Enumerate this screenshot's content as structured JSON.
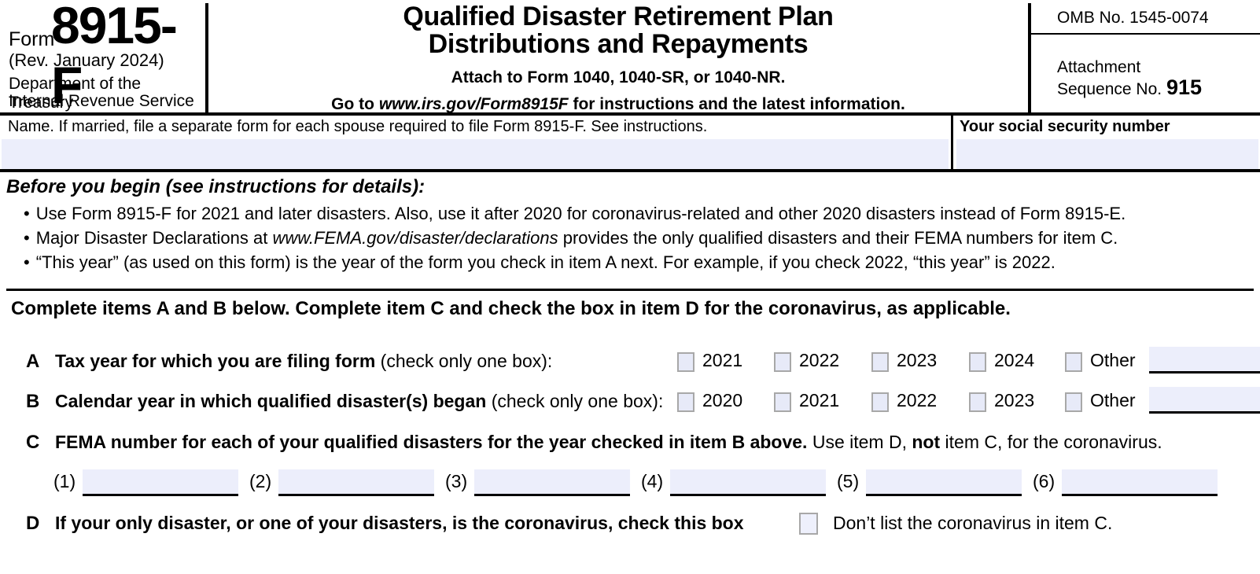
{
  "header": {
    "form_word": "Form",
    "form_number": "8915-F",
    "revision": "(Rev. January 2024)",
    "department_line1": "Department of the Treasury",
    "department_line2": "Internal Revenue Service",
    "title_line1": "Qualified Disaster Retirement Plan",
    "title_line2": "Distributions and Repayments",
    "attach_to": "Attach to Form 1040, 1040-SR, or 1040-NR.",
    "goto_prefix": "Go to ",
    "goto_url": "www.irs.gov/Form8915F",
    "goto_suffix": " for instructions and the latest information.",
    "omb": "OMB No. 1545-0074",
    "attachment_label1": "Attachment",
    "attachment_label2": "Sequence No. ",
    "attachment_number": "915"
  },
  "identity": {
    "name_label": "Name. If married, file a separate form for each spouse required to file Form 8915-F. See instructions.",
    "name_value": "",
    "ssn_label": "Your social security number",
    "ssn_value": ""
  },
  "before_you_begin": {
    "heading": "Before you begin (see instructions for details):",
    "bullets": [
      {
        "pre": "Use Form 8915-F for 2021 and later disasters. Also, use it after 2020 for coronavirus-related and other 2020 disasters instead of Form 8915-E.",
        "italic": "",
        "post": ""
      },
      {
        "pre": "Major Disaster Declarations at ",
        "italic": "www.FEMA.gov/disaster/declarations",
        "post": " provides the only qualified disasters and their FEMA numbers for item C."
      },
      {
        "pre": "“This year” (as used on this form) is the year of the form you check in item A next. For example, if you check 2022, “this year” is 2022.",
        "italic": "",
        "post": ""
      }
    ],
    "bullet_glyph": "•"
  },
  "instructions": {
    "complete_items": "Complete items A and B below. Complete item C and check the box in item D for the coronavirus, as applicable."
  },
  "item_a": {
    "letter": "A",
    "label_bold": "Tax year for which you are filing form",
    "label_rest": " (check only one box):",
    "options": [
      "2021",
      "2022",
      "2023",
      "2024"
    ],
    "other_label": "Other",
    "other_value": ""
  },
  "item_b": {
    "letter": "B",
    "label_bold": "Calendar year in which qualified disaster(s) began",
    "label_rest": " (check only one box):",
    "options": [
      "2020",
      "2021",
      "2022",
      "2023"
    ],
    "other_label": "Other",
    "other_value": ""
  },
  "item_c": {
    "letter": "C",
    "label_bold": "FEMA number for each of your qualified disasters for the year checked in item B above.",
    "label_mid": " Use item D, ",
    "label_not": "not",
    "label_end": " item C, for the coronavirus.",
    "numbers": [
      "(1)",
      "(2)",
      "(3)",
      "(4)",
      "(5)",
      "(6)"
    ],
    "values": [
      "",
      "",
      "",
      "",
      "",
      ""
    ]
  },
  "item_d": {
    "letter": "D",
    "label_bold": "If your only disaster, or one of your disasters, is the coronavirus, check this box",
    "note": "Don’t list the coronavirus in item C.",
    "checked": false
  },
  "colors": {
    "field_fill": "#eceefb",
    "checkbox_fill": "#e7eaf8",
    "checkbox_border": "#a8a8a8",
    "rule": "#000000"
  }
}
